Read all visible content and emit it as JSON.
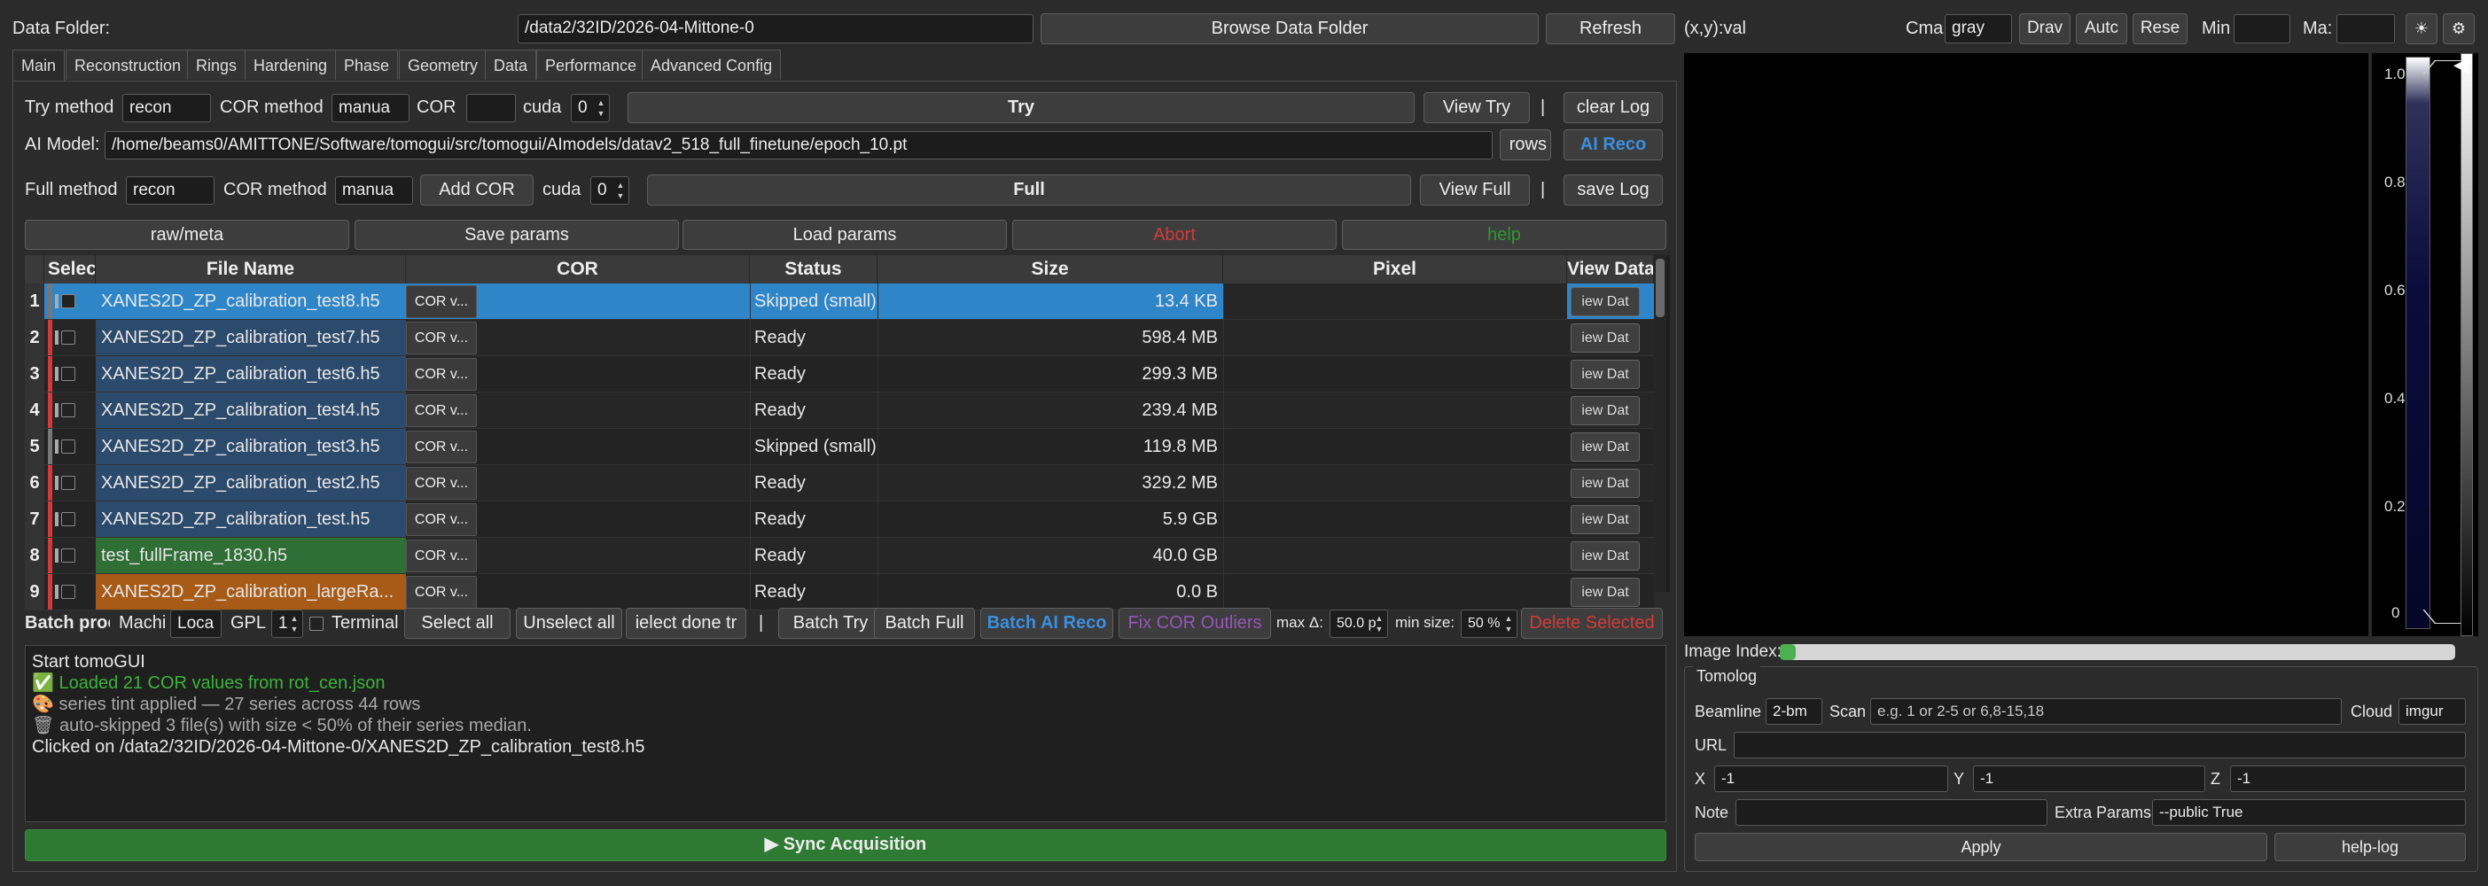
{
  "header": {
    "data_folder_label": "Data Folder:",
    "data_folder_value": "/data2/32ID/2026-04-Mittone-0",
    "browse_button": "Browse Data Folder",
    "refresh_button": "Refresh",
    "coord_readout": "(x,y):val",
    "cmap_label": "Cma",
    "cmap_value": "gray",
    "draw_button": "Drav",
    "auto_button": "Autc",
    "reset_button": "Rese",
    "min_label": "Min",
    "max_label": "Ma:",
    "sun_icon": "sun-icon",
    "gear_icon": "gear-icon"
  },
  "tabs": [
    "Main",
    "Reconstruction",
    "Rings",
    "Hardening",
    "Phase",
    "Geometry",
    "Data",
    "Performance",
    "Advanced Config"
  ],
  "try_row": {
    "method_label": "Try method",
    "method_value": "recon",
    "cor_method_label": "COR method",
    "cor_method_value": "manua",
    "cor_label": "COR",
    "cor_value": "",
    "cuda_label": "cuda",
    "cuda_value": "0",
    "try_button": "Try",
    "view_try_button": "View Try",
    "sep": "|",
    "clear_log_button": "clear Log"
  },
  "ai_row": {
    "label": "AI Model:",
    "path": "/home/beams0/AMITTONE/Software/tomogui/src/tomogui/AImodels/datav2_518_full_finetune/epoch_10.pt",
    "browse_button": "rows",
    "ai_reco_button": "AI Reco"
  },
  "full_row": {
    "method_label": "Full method",
    "method_value": "recon",
    "cor_method_label": "COR method",
    "cor_method_value": "manua",
    "add_cor_button": "Add COR",
    "cuda_label": "cuda",
    "cuda_value": "0",
    "full_button": "Full",
    "view_full_button": "View Full",
    "sep": "|",
    "save_log_button": "save Log"
  },
  "action_row": {
    "raw_meta": "raw/meta",
    "save_params": "Save params",
    "load_params": "Load params",
    "abort": "Abort",
    "help": "help"
  },
  "table": {
    "headers": [
      "Selec",
      "File Name",
      "COR",
      "Status",
      "Size",
      "Pixel",
      "View Data"
    ],
    "rows": [
      {
        "num": "1",
        "name": "XANES2D_ZP_calibration_test8.h5",
        "cor": "COR v...",
        "status": "Skipped (small)",
        "size": "13.4 KB",
        "view": "iew Dat"
      },
      {
        "num": "2",
        "name": "XANES2D_ZP_calibration_test7.h5",
        "cor": "COR v...",
        "status": "Ready",
        "size": "598.4 MB",
        "view": "iew Dat"
      },
      {
        "num": "3",
        "name": "XANES2D_ZP_calibration_test6.h5",
        "cor": "COR v...",
        "status": "Ready",
        "size": "299.3 MB",
        "view": "iew Dat"
      },
      {
        "num": "4",
        "name": "XANES2D_ZP_calibration_test4.h5",
        "cor": "COR v...",
        "status": "Ready",
        "size": "239.4 MB",
        "view": "iew Dat"
      },
      {
        "num": "5",
        "name": "XANES2D_ZP_calibration_test3.h5",
        "cor": "COR v...",
        "status": "Skipped (small)",
        "size": "119.8 MB",
        "view": "iew Dat"
      },
      {
        "num": "6",
        "name": "XANES2D_ZP_calibration_test2.h5",
        "cor": "COR v...",
        "status": "Ready",
        "size": "329.2 MB",
        "view": "iew Dat"
      },
      {
        "num": "7",
        "name": "XANES2D_ZP_calibration_test.h5",
        "cor": "COR v...",
        "status": "Ready",
        "size": "5.9 GB",
        "view": "iew Dat"
      },
      {
        "num": "8",
        "name": "test_fullFrame_1830.h5",
        "cor": "COR v...",
        "status": "Ready",
        "size": "40.0 GB",
        "view": "iew Dat"
      },
      {
        "num": "9",
        "name": "XANES2D_ZP_calibration_largeRa...",
        "cor": "COR v...",
        "status": "Ready",
        "size": "0.0 B",
        "view": "iew Dat"
      }
    ]
  },
  "batch_row": {
    "label": "Batch proc",
    "machine_label": "Machi",
    "machine_value": "Loca",
    "gpu_label": "GPL",
    "gpu_value": "1",
    "terminal_label": "Terminal",
    "select_all": "Select all",
    "unselect_all": "Unselect all",
    "select_done": "ielect done tr",
    "sep": "|",
    "batch_try": "Batch Try",
    "batch_full": "Batch Full",
    "batch_ai": "Batch AI Reco",
    "fix_cor": "Fix COR Outliers",
    "max_delta_label": "max Δ:",
    "max_delta_value": "50.0 p",
    "min_size_label": "min size:",
    "min_size_value": "50 %",
    "delete_selected": "Delete Selected"
  },
  "log": [
    {
      "text": "Start tomoGUI",
      "color": "#e8e8e8"
    },
    {
      "text": "✅ Loaded 21 COR values from rot_cen.json",
      "color": "#3bb33b"
    },
    {
      "text": "🎨 series tint applied — 27 series across 44 rows",
      "color": "#a8a8a8"
    },
    {
      "text": "🗑 auto-skipped 3 file(s) with size < 50% of their series median.",
      "color": "#a8a8a8"
    },
    {
      "text": "Clicked on /data2/32ID/2026-04-Mittone-0/XANES2D_ZP_calibration_test8.h5",
      "color": "#e8e8e8"
    }
  ],
  "sync_button": "▶  Sync Acquisition",
  "image_viewer": {
    "colorbar_ticks": [
      "1.0",
      "0.8",
      "0.6",
      "0.4",
      "0.2",
      "0"
    ],
    "image_index_label": "Image Index:",
    "image_index_fraction": 0.02
  },
  "tomolog": {
    "title": "Tomolog",
    "beamline_label": "Beamline",
    "beamline_value": "2-bm",
    "scan_label": "Scan",
    "scan_placeholder": "e.g. 1 or 2-5 or 6,8-15,18",
    "cloud_label": "Cloud",
    "cloud_value": "imgur",
    "url_label": "URL",
    "url_value": "",
    "x_label": "X",
    "x_value": "-1",
    "y_label": "Y",
    "y_value": "-1",
    "z_label": "Z",
    "z_value": "-1",
    "note_label": "Note",
    "note_value": "",
    "extra_label": "Extra Params",
    "extra_value": "--public True",
    "apply_button": "Apply",
    "helplog_button": "help-log"
  },
  "colors": {
    "row_selected": "#2e86c9",
    "name_blue": "#2c4a6b",
    "name_green": "#2f6e34",
    "name_orange": "#a85a17",
    "ai_blue": "#3b8fe0",
    "abort_red": "#d23a3a",
    "help_green": "#2f9a2f",
    "fix_purple": "#9457b8",
    "sync_green": "#2f7a33"
  }
}
